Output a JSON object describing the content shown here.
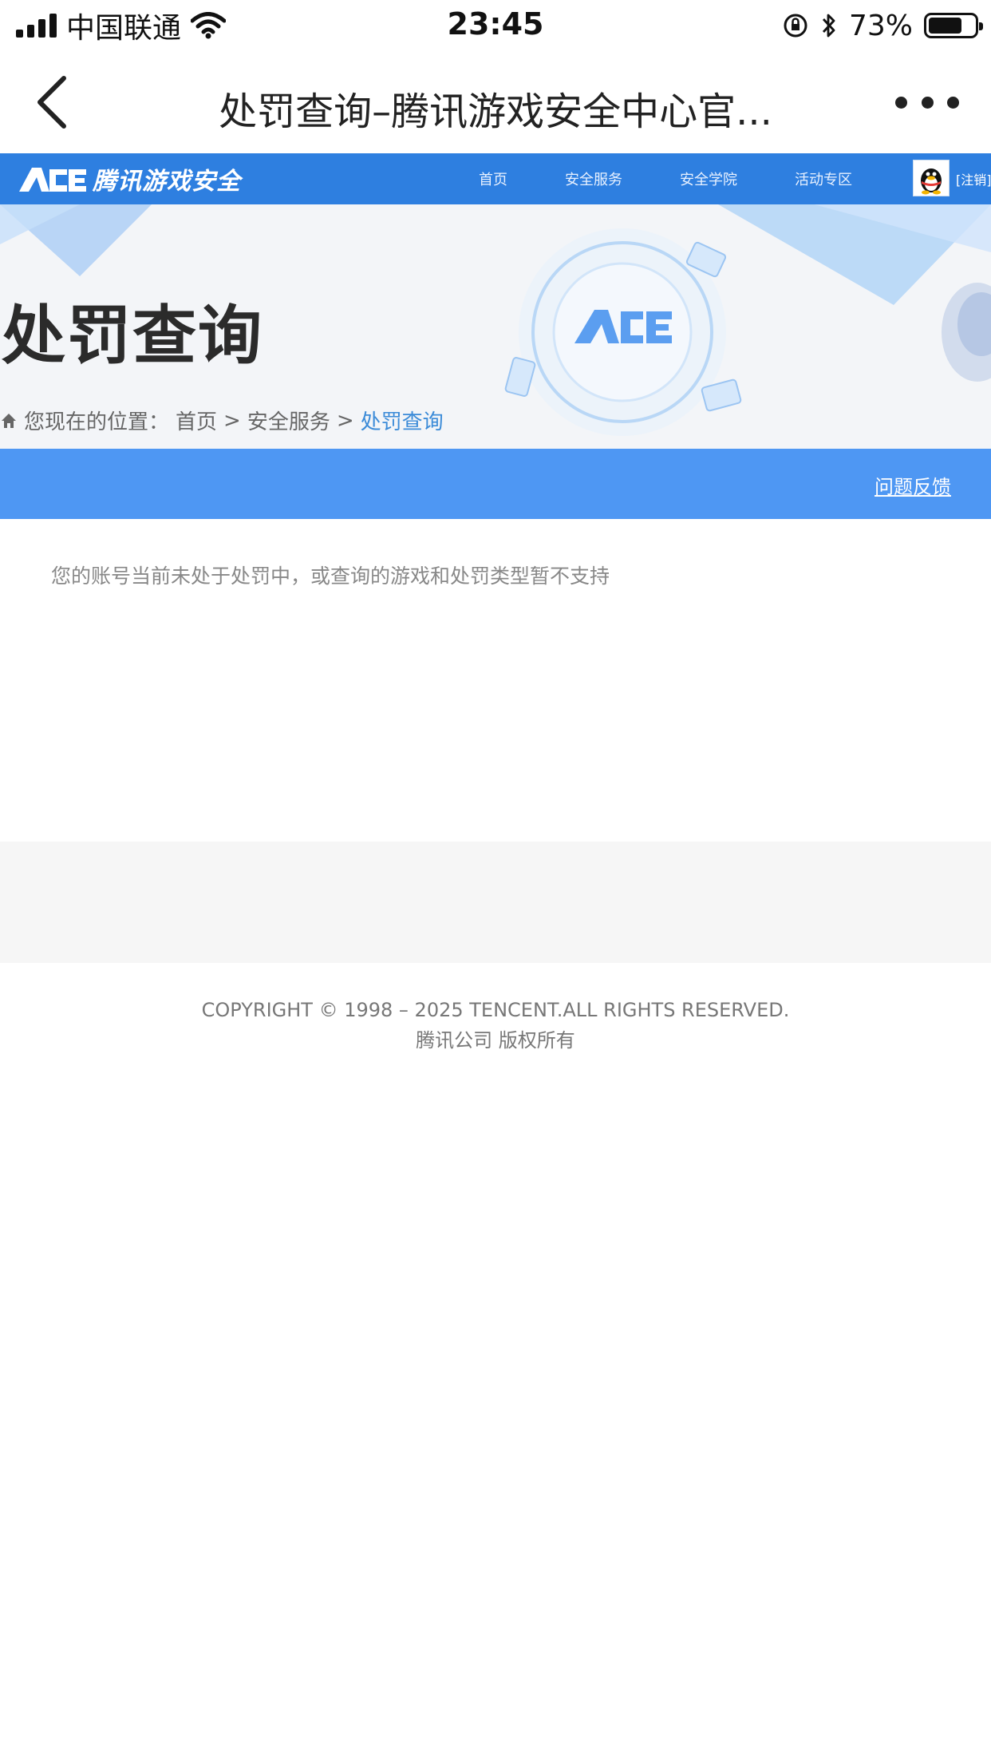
{
  "status_bar": {
    "carrier": "中国联通",
    "time": "23:45",
    "battery": "73%",
    "battery_level": 0.73
  },
  "nav_bar": {
    "title": "处罚查询–腾讯游戏安全中心官..."
  },
  "site_header": {
    "logo_text": "腾讯游戏安全",
    "nav_items": [
      "首页",
      "安全服务",
      "安全学院",
      "活动专区"
    ],
    "logout": "[注销]"
  },
  "banner": {
    "title": "处罚查询",
    "breadcrumb": {
      "prefix": "您现在的位置：",
      "items": [
        "首页",
        "安全服务"
      ],
      "separator": ">",
      "current": "处罚查询"
    }
  },
  "action_bar": {
    "feedback_link": "问题反馈"
  },
  "content": {
    "message": "您的账号当前未处于处罚中，或查询的游戏和处罚类型暂不支持"
  },
  "footer": {
    "copyright": "COPYRIGHT © 1998 – 2025 TENCENT.ALL RIGHTS RESERVED.",
    "company": "腾讯公司 版权所有"
  },
  "colors": {
    "header_blue": "#2e7fe0",
    "bar_blue": "#4e97f3",
    "breadcrumb_active": "#3b8bd8"
  }
}
